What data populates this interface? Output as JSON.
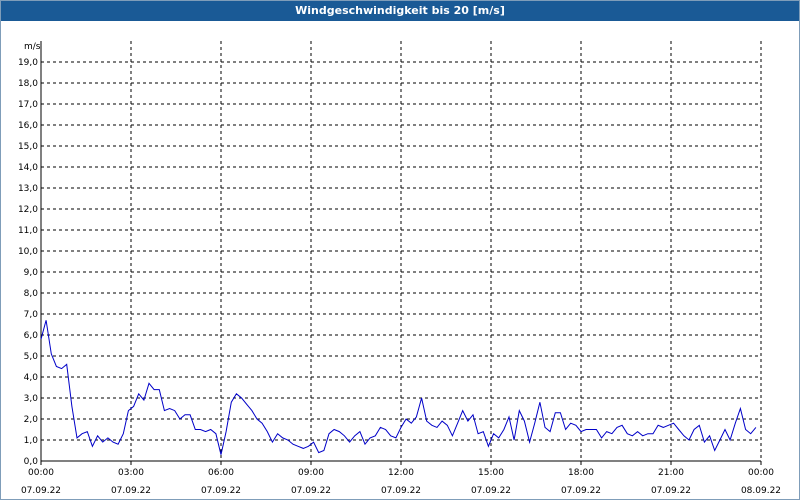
{
  "window": {
    "title": "Windgeschwindigkeit bis 20 [m/s]"
  },
  "chart_data": {
    "type": "line",
    "title": "Windgeschwindigkeit bis 20 [m/s]",
    "ylabel": "m/s",
    "xlabel": "",
    "ylim": [
      0,
      20
    ],
    "xlim_hours": [
      0,
      24
    ],
    "grid": true,
    "grid_style": "dashed",
    "y_ticks": [
      "0,0",
      "1,0",
      "2,0",
      "3,0",
      "4,0",
      "5,0",
      "6,0",
      "7,0",
      "8,0",
      "9,0",
      "10,0",
      "11,0",
      "12,0",
      "13,0",
      "14,0",
      "15,0",
      "16,0",
      "17,0",
      "18,0",
      "19,0"
    ],
    "x_ticks": [
      {
        "time": "00:00",
        "date": "07.09.22"
      },
      {
        "time": "03:00",
        "date": "07.09.22"
      },
      {
        "time": "06:00",
        "date": "07.09.22"
      },
      {
        "time": "09:00",
        "date": "07.09.22"
      },
      {
        "time": "12:00",
        "date": "07.09.22"
      },
      {
        "time": "15:00",
        "date": "07.09.22"
      },
      {
        "time": "18:00",
        "date": "07.09.22"
      },
      {
        "time": "21:00",
        "date": "07.09.22"
      },
      {
        "time": "00:00",
        "date": "08.09.22"
      }
    ],
    "line_color": "#0000c8",
    "series": [
      {
        "values": [
          [
            0.0,
            5.8
          ],
          [
            0.2,
            6.7
          ],
          [
            0.4,
            5.1
          ],
          [
            0.6,
            4.5
          ],
          [
            0.8,
            4.4
          ],
          [
            1.0,
            4.6
          ],
          [
            1.2,
            2.6
          ],
          [
            1.4,
            1.1
          ],
          [
            1.6,
            1.3
          ],
          [
            1.8,
            1.4
          ],
          [
            2.0,
            0.7
          ],
          [
            2.2,
            1.2
          ],
          [
            2.4,
            0.9
          ],
          [
            2.6,
            1.1
          ],
          [
            2.8,
            0.9
          ],
          [
            3.0,
            0.8
          ],
          [
            3.2,
            1.3
          ],
          [
            3.4,
            2.4
          ],
          [
            3.6,
            2.6
          ],
          [
            3.8,
            3.2
          ],
          [
            4.0,
            2.9
          ],
          [
            4.2,
            3.7
          ],
          [
            4.4,
            3.4
          ],
          [
            4.6,
            3.4
          ],
          [
            4.8,
            2.4
          ],
          [
            5.0,
            2.5
          ],
          [
            5.2,
            2.4
          ],
          [
            5.4,
            2.0
          ],
          [
            5.6,
            2.2
          ],
          [
            5.8,
            2.2
          ],
          [
            6.0,
            1.5
          ],
          [
            6.2,
            1.5
          ],
          [
            6.4,
            1.4
          ],
          [
            6.6,
            1.5
          ],
          [
            6.8,
            1.3
          ],
          [
            7.0,
            0.3
          ],
          [
            7.2,
            1.4
          ],
          [
            7.4,
            2.8
          ],
          [
            7.6,
            3.2
          ],
          [
            7.8,
            3.0
          ],
          [
            8.0,
            2.7
          ],
          [
            8.2,
            2.4
          ],
          [
            8.4,
            2.0
          ],
          [
            8.6,
            1.8
          ],
          [
            8.8,
            1.4
          ],
          [
            9.0,
            0.9
          ],
          [
            9.2,
            1.3
          ],
          [
            9.4,
            1.1
          ],
          [
            9.6,
            1.0
          ],
          [
            9.8,
            0.8
          ],
          [
            10.0,
            0.7
          ],
          [
            10.2,
            0.6
          ],
          [
            10.4,
            0.7
          ],
          [
            10.6,
            0.9
          ],
          [
            10.8,
            0.4
          ],
          [
            11.0,
            0.5
          ],
          [
            11.2,
            1.3
          ],
          [
            11.4,
            1.5
          ],
          [
            11.6,
            1.4
          ],
          [
            11.8,
            1.2
          ],
          [
            12.0,
            0.9
          ],
          [
            12.2,
            1.2
          ],
          [
            12.4,
            1.4
          ],
          [
            12.6,
            0.8
          ],
          [
            12.8,
            1.1
          ],
          [
            13.0,
            1.2
          ],
          [
            13.2,
            1.6
          ],
          [
            13.4,
            1.5
          ],
          [
            13.6,
            1.2
          ],
          [
            13.8,
            1.1
          ],
          [
            14.0,
            1.6
          ],
          [
            14.2,
            2.0
          ],
          [
            14.4,
            1.8
          ],
          [
            14.6,
            2.1
          ],
          [
            14.8,
            3.0
          ],
          [
            15.0,
            1.9
          ],
          [
            15.2,
            1.7
          ],
          [
            15.4,
            1.6
          ],
          [
            15.6,
            1.9
          ],
          [
            15.8,
            1.7
          ],
          [
            16.0,
            1.2
          ],
          [
            16.2,
            1.8
          ],
          [
            16.4,
            2.4
          ],
          [
            16.6,
            1.9
          ],
          [
            16.8,
            2.2
          ],
          [
            17.0,
            1.3
          ],
          [
            17.2,
            1.4
          ],
          [
            17.4,
            0.7
          ],
          [
            17.6,
            1.3
          ],
          [
            17.8,
            1.1
          ],
          [
            18.0,
            1.5
          ],
          [
            18.2,
            2.1
          ],
          [
            18.4,
            1.0
          ],
          [
            18.6,
            2.4
          ],
          [
            18.8,
            1.9
          ],
          [
            19.0,
            0.9
          ],
          [
            19.2,
            1.8
          ],
          [
            19.4,
            2.8
          ],
          [
            19.6,
            1.6
          ],
          [
            19.8,
            1.4
          ],
          [
            20.0,
            2.3
          ],
          [
            20.2,
            2.3
          ],
          [
            20.4,
            1.5
          ],
          [
            20.6,
            1.8
          ],
          [
            20.8,
            1.7
          ],
          [
            21.0,
            1.4
          ],
          [
            21.2,
            1.5
          ],
          [
            21.4,
            1.5
          ],
          [
            21.6,
            1.5
          ],
          [
            21.8,
            1.1
          ],
          [
            22.0,
            1.4
          ],
          [
            22.2,
            1.3
          ],
          [
            22.4,
            1.6
          ],
          [
            22.6,
            1.7
          ],
          [
            22.8,
            1.3
          ],
          [
            23.0,
            1.2
          ],
          [
            23.2,
            1.4
          ],
          [
            23.4,
            1.2
          ],
          [
            23.6,
            1.3
          ],
          [
            23.8,
            1.3
          ],
          [
            24.0,
            1.7
          ],
          [
            24.2,
            1.6
          ],
          [
            24.4,
            1.7
          ],
          [
            24.6,
            1.8
          ],
          [
            24.8,
            1.5
          ],
          [
            25.0,
            1.2
          ],
          [
            25.2,
            1.0
          ],
          [
            25.4,
            1.5
          ],
          [
            25.6,
            1.7
          ],
          [
            25.8,
            0.9
          ],
          [
            26.0,
            1.2
          ],
          [
            26.2,
            0.5
          ],
          [
            26.4,
            1.0
          ],
          [
            26.6,
            1.5
          ],
          [
            26.8,
            1.0
          ],
          [
            27.0,
            1.8
          ],
          [
            27.2,
            2.5
          ],
          [
            27.4,
            1.5
          ],
          [
            27.6,
            1.3
          ],
          [
            27.8,
            1.6
          ]
        ]
      }
    ]
  }
}
